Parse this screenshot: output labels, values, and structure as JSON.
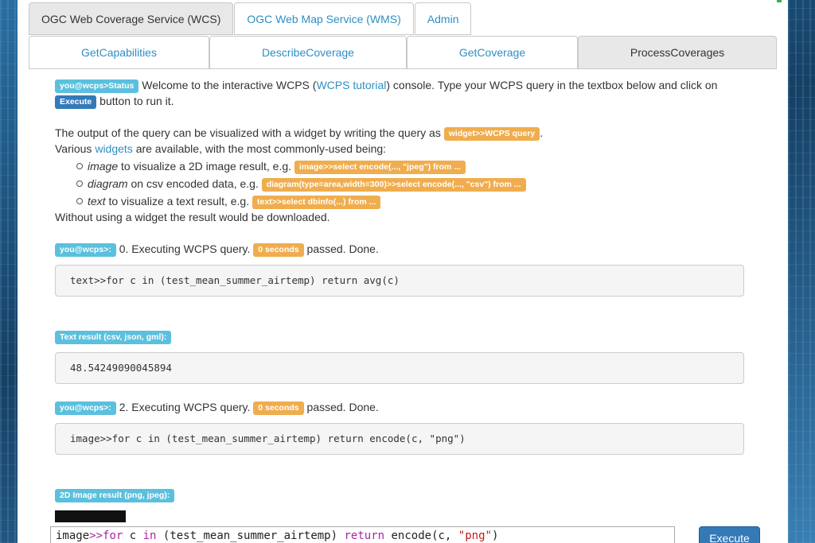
{
  "top_tabs": [
    "OGC Web Coverage Service (WCS)",
    "OGC Web Map Service (WMS)",
    "Admin"
  ],
  "sub_tabs": [
    "GetCapabilities",
    "DescribeCoverage",
    "GetCoverage",
    "ProcessCoverages"
  ],
  "intro": {
    "status_label": "you@wcps>Status",
    "text1": "Welcome to the interactive WCPS (",
    "link": "WCPS tutorial",
    "text2": ") console. Type your WCPS query in the textbox below and click on",
    "execute_label": "Execute",
    "text3": "button to run it."
  },
  "widget_info": {
    "text1": "The output of the query can be visualized with a widget by writing the query as",
    "widget_label": "widget>>WCPS query",
    "text2": ".",
    "various": "Various",
    "widgets_link": "widgets",
    "various_rest": "are available, with the most commonly-used being:",
    "items": [
      {
        "name": "image",
        "desc": "to visualize a 2D image result, e.g.",
        "example": "image>>select encode(..., \"jpeg\") from ..."
      },
      {
        "name": "diagram",
        "desc": "on csv encoded data, e.g.",
        "example": "diagram(type=area,width=300)>>select encode(..., \"csv\") from ..."
      },
      {
        "name": "text",
        "desc": "to visualize a text result, e.g.",
        "example": "text>>select dbinfo(...) from ..."
      }
    ],
    "footer": "Without using a widget the result would be downloaded."
  },
  "log": [
    {
      "prompt": "you@wcps>:",
      "text": "0. Executing WCPS query.",
      "time": "0 seconds",
      "status": "passed. Done.",
      "query": "text>>for c in (test_mean_summer_airtemp) return avg(c)"
    },
    {
      "result_label": "Text result (csv, json, gml):",
      "result": "48.54249090045894"
    },
    {
      "prompt": "you@wcps>:",
      "text": "2. Executing WCPS query.",
      "time": "0 seconds",
      "status": "passed. Done.",
      "query": "image>>for c in (test_mean_summer_airtemp) return encode(c, \"png\")"
    },
    {
      "result_label": "2D Image result (png, jpeg):"
    }
  ],
  "editor": {
    "t1": "image",
    "t2": ">>",
    "t3": "for",
    "t4": " c ",
    "t5": "in",
    "t6": " (test_mean_summer_airtemp) ",
    "t7": "return",
    "t8": " encode(c, ",
    "t9": "\"png\"",
    "t10": ")"
  },
  "execute_button": "Execute",
  "colors": {
    "primary": "#337ab7",
    "info": "#5bc0de",
    "warning": "#f0ad4e",
    "link": "#2f8fc3"
  }
}
